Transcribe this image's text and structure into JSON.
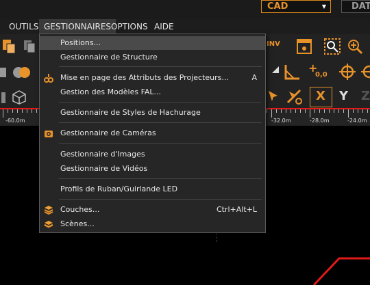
{
  "top_combo": {
    "value": "CAD",
    "second_value": "DAT"
  },
  "menubar": {
    "items": [
      {
        "label": "OUTILS"
      },
      {
        "label": "GESTIONNAIRES"
      },
      {
        "label": "OPTIONS"
      },
      {
        "label": "AIDE"
      }
    ]
  },
  "toolbar": {
    "letter_a": "A",
    "letter_x": "X",
    "letter_y": "Y",
    "letter_z": "Z",
    "origin_label": "0,0",
    "inv_label": "INV"
  },
  "ruler": {
    "labels": [
      "-60.0m",
      "-32.0m",
      "-28.0m",
      "-24.0m"
    ]
  },
  "dropdown": {
    "items": [
      {
        "label": "Positions...",
        "shortcut": "",
        "icon": "",
        "highlighted": true
      },
      {
        "label": "Gestionnaire de Structure",
        "shortcut": "",
        "icon": ""
      },
      {
        "label": "Mise en page des Attributs des Projecteurs...",
        "shortcut": "A",
        "icon": "projector-icon"
      },
      {
        "label": "Gestion des Modèles FAL...",
        "shortcut": "",
        "icon": ""
      },
      {
        "label": "Gestionnaire de Styles de Hachurage",
        "shortcut": "",
        "icon": ""
      },
      {
        "label": "Gestionnaire de Caméras",
        "shortcut": "",
        "icon": "camera-icon"
      },
      {
        "label": "Gestionnaire d'Images",
        "shortcut": "",
        "icon": ""
      },
      {
        "label": "Gestionnaire de Vidéos",
        "shortcut": "",
        "icon": ""
      },
      {
        "label": "Profils de Ruban/Guirlande LED",
        "shortcut": "",
        "icon": ""
      },
      {
        "label": "Couches...",
        "shortcut": "Ctrl+Alt+L",
        "icon": "layers-icon"
      },
      {
        "label": "Scènes...",
        "shortcut": "",
        "icon": "scenes-icon"
      }
    ]
  },
  "colors": {
    "accent": "#e8922a",
    "ruler_red": "#e21a1a",
    "menu_bg": "#262626"
  }
}
